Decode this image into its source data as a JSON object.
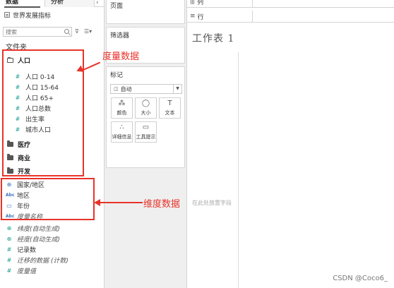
{
  "left_pane": {
    "tabs": {
      "data": "数据",
      "analysis": "分析",
      "collapse": "‹"
    },
    "datasource": "世界发展指标",
    "search_placeholder": "搜索",
    "filter_symbol": "⊽",
    "view_symbol": "☰▾",
    "folder_header": "文件夹",
    "groups": [
      {
        "label": "人口",
        "open": true,
        "children": [
          "人口 0-14",
          "人口 15-64",
          "人口 65+",
          "人口总数",
          "出生率",
          "城市人口"
        ]
      },
      {
        "label": "医疗",
        "open": false
      },
      {
        "label": "商业",
        "open": false
      },
      {
        "label": "开发",
        "open": false
      }
    ],
    "dimensions": [
      {
        "label": "国家/地区",
        "icon": "globe-icon"
      },
      {
        "label": "地区",
        "icon": "abc-icon"
      },
      {
        "label": "年份",
        "icon": "calendar-icon"
      },
      {
        "label": "度量名称",
        "icon": "abc-icon",
        "italic": true
      }
    ],
    "extras": [
      {
        "label": "纬度(自动生成)",
        "icon": "globe-icon",
        "italic": true
      },
      {
        "label": "经度(自动生成)",
        "icon": "globe-icon",
        "italic": true
      },
      {
        "label": "记录数",
        "icon": "measure-icon",
        "italic": false
      },
      {
        "label": "迁移的数据 (计数)",
        "icon": "measure-icon",
        "italic": true
      },
      {
        "label": "度量值",
        "icon": "measure-icon",
        "italic": true
      }
    ],
    "field_glyphs": {
      "measure": "#",
      "globe": "⊕",
      "abc": "Abc",
      "calendar": "▭"
    }
  },
  "annotations": {
    "measure_label": "度量数据",
    "dimension_label": "维度数据",
    "color": "#e8332a"
  },
  "middle_pane": {
    "pages": "页面",
    "filters": "筛选器",
    "marks": "标记",
    "mark_type": "自动",
    "mark_type_glyph": "◫",
    "mark_buttons": [
      {
        "label": "颜色",
        "glyph": "⁂",
        "icon": "color-icon"
      },
      {
        "label": "大小",
        "glyph": "◯",
        "icon": "size-icon"
      },
      {
        "label": "文本",
        "glyph": "T",
        "icon": "text-icon"
      },
      {
        "label": "详细信息",
        "glyph": "∴",
        "icon": "detail-icon"
      },
      {
        "label": "工具提示",
        "glyph": "▭",
        "icon": "tooltip-icon"
      }
    ]
  },
  "worksheet": {
    "columns_label": "列",
    "rows_label": "行",
    "columns_glyph": "|||",
    "rows_glyph": "≡",
    "title": "工作表 1",
    "drop_hint": "在此处放置字段"
  },
  "watermark": "CSDN @Coco6_"
}
